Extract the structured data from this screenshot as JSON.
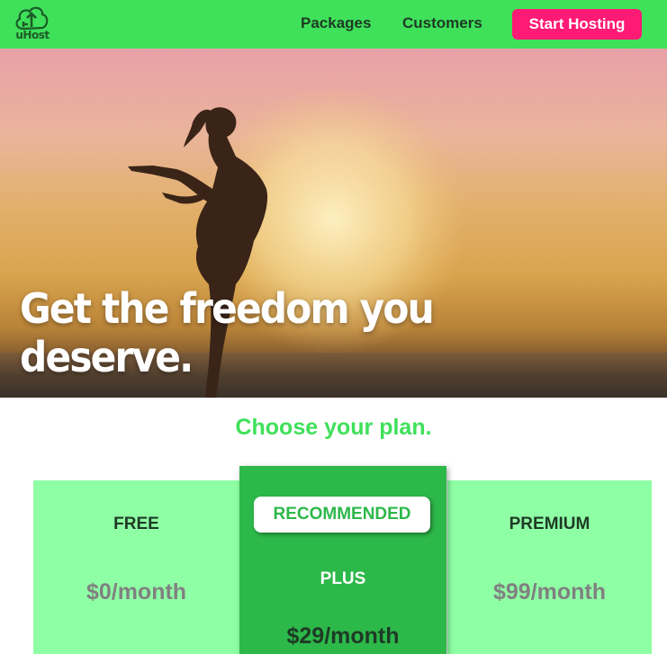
{
  "nav": {
    "logo_text": "uHost",
    "links": [
      "Packages",
      "Customers"
    ],
    "cta_label": "Start Hosting"
  },
  "hero": {
    "title": "Get the freedom you deserve."
  },
  "plans": {
    "heading": "Choose your plan.",
    "items": [
      {
        "name": "FREE",
        "price": "$0/month"
      },
      {
        "badge": "RECOMMENDED",
        "name": "PLUS",
        "price": "$29/month"
      },
      {
        "name": "PREMIUM",
        "price": "$99/month"
      }
    ]
  },
  "colors": {
    "nav_bg": "#3fe05a",
    "cta_bg": "#ff1a75",
    "card_bg": "#8fffa5",
    "recommended_bg": "#2db84a"
  }
}
